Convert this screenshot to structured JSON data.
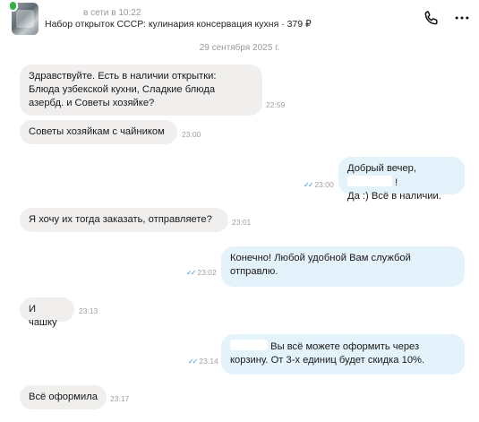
{
  "header": {
    "status": "в сети в 10:22",
    "title": "Набор открыток СССР: кулинария консервация кухня · 379 ₽"
  },
  "date_separator": "29 сентября 2025 г.",
  "messages": [
    {
      "text_lines": [
        "Здравствуйте. Есть в наличии открытки:",
        "Блюда узбекской кухни, Сладкие блюда",
        "азербд. и Советы хозяйке?"
      ],
      "time": "22:59"
    },
    {
      "text": "Советы хозяйкам с чайником",
      "time": "23:00"
    },
    {
      "line1_start": "Добрый вечер,",
      "line1_end": "!",
      "line2": "Да :) Всё в наличии.",
      "time": "23:00"
    },
    {
      "text": "Я хочу их тогда заказать, отправляете?",
      "time": "23:01"
    },
    {
      "text_lines": [
        "Конечно! Любой удобной Вам службой",
        "отправлю."
      ],
      "time": "23:02"
    },
    {
      "text": "И чашку",
      "time": "23:13"
    },
    {
      "line1": "Вы всё можете оформить через",
      "line2": "корзину. От 3-х единиц будет скидка 10%.",
      "time": "23:14"
    },
    {
      "text": "Всё оформила",
      "time": "23:17"
    }
  ],
  "icons": {
    "check": "double-check-icon",
    "call": "phone-icon",
    "more": "more-vertical-icon"
  }
}
